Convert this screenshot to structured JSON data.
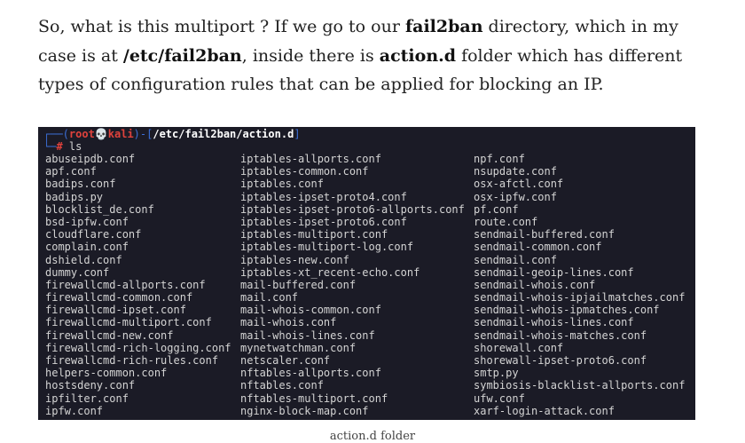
{
  "paragraph": {
    "t1": "So, what is this multiport ? If we go to our ",
    "b1": "fail2ban",
    "t2": " directory, which in my case is at ",
    "b2": "/etc/fail2ban",
    "t3": ", inside there is ",
    "b3": "action.d",
    "t4": " folder which has different types of configuration rules that can be applied for blocking an IP."
  },
  "terminal": {
    "prompt_open": "┌──(",
    "user": "root",
    "skull": "💀",
    "host": "kali",
    "prompt_mid": ")-[",
    "path": "/etc/fail2ban/action.d",
    "prompt_close": "]",
    "prompt_line2": "└─",
    "hash": "#",
    "command": " ls",
    "columns": [
      [
        "abuseipdb.conf",
        "apf.conf",
        "badips.conf",
        "badips.py",
        "blocklist_de.conf",
        "bsd-ipfw.conf",
        "cloudflare.conf",
        "complain.conf",
        "dshield.conf",
        "dummy.conf",
        "firewallcmd-allports.conf",
        "firewallcmd-common.conf",
        "firewallcmd-ipset.conf",
        "firewallcmd-multiport.conf",
        "firewallcmd-new.conf",
        "firewallcmd-rich-logging.conf",
        "firewallcmd-rich-rules.conf",
        "helpers-common.conf",
        "hostsdeny.conf",
        "ipfilter.conf",
        "ipfw.conf"
      ],
      [
        "iptables-allports.conf",
        "iptables-common.conf",
        "iptables.conf",
        "iptables-ipset-proto4.conf",
        "iptables-ipset-proto6-allports.conf",
        "iptables-ipset-proto6.conf",
        "iptables-multiport.conf",
        "iptables-multiport-log.conf",
        "iptables-new.conf",
        "iptables-xt_recent-echo.conf",
        "mail-buffered.conf",
        "mail.conf",
        "mail-whois-common.conf",
        "mail-whois.conf",
        "mail-whois-lines.conf",
        "mynetwatchman.conf",
        "netscaler.conf",
        "nftables-allports.conf",
        "nftables.conf",
        "nftables-multiport.conf",
        "nginx-block-map.conf"
      ],
      [
        "npf.conf",
        "nsupdate.conf",
        "osx-afctl.conf",
        "osx-ipfw.conf",
        "pf.conf",
        "route.conf",
        "sendmail-buffered.conf",
        "sendmail-common.conf",
        "sendmail.conf",
        "sendmail-geoip-lines.conf",
        "sendmail-whois.conf",
        "sendmail-whois-ipjailmatches.conf",
        "sendmail-whois-ipmatches.conf",
        "sendmail-whois-lines.conf",
        "sendmail-whois-matches.conf",
        "shorewall.conf",
        "shorewall-ipset-proto6.conf",
        "smtp.py",
        "symbiosis-blacklist-allports.conf",
        "ufw.conf",
        "xarf-login-attack.conf"
      ]
    ]
  },
  "caption": "action.d folder"
}
